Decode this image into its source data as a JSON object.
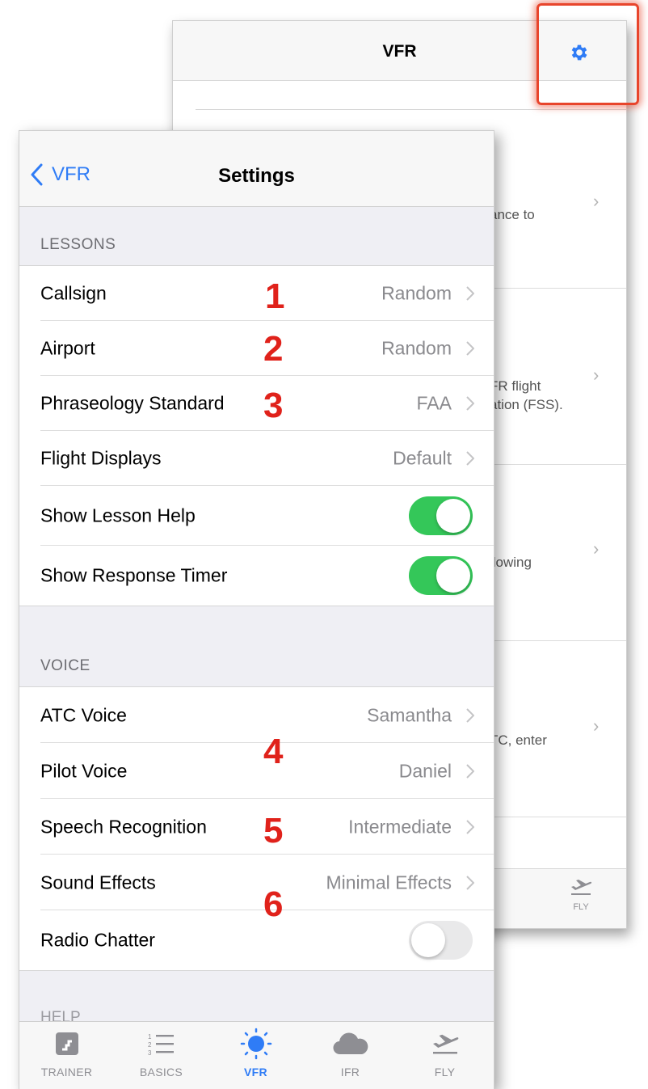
{
  "background_screen": {
    "title": "VFR",
    "row_snippets": [
      "ance to",
      "FR flight\nation (FSS).",
      "llowing",
      "TC, enter"
    ],
    "tab_fly_label": "FLY"
  },
  "settings": {
    "back_label": "VFR",
    "title": "Settings",
    "sections": {
      "lessons_header": "LESSONS",
      "voice_header": "VOICE",
      "help_header_peek": "HELP"
    },
    "lessons": [
      {
        "label": "Callsign",
        "value": "Random"
      },
      {
        "label": "Airport",
        "value": "Random"
      },
      {
        "label": "Phraseology Standard",
        "value": "FAA"
      },
      {
        "label": "Flight Displays",
        "value": "Default"
      },
      {
        "label": "Show Lesson Help",
        "toggle": true
      },
      {
        "label": "Show Response Timer",
        "toggle": true
      }
    ],
    "voice": [
      {
        "label": "ATC Voice",
        "value": "Samantha"
      },
      {
        "label": "Pilot Voice",
        "value": "Daniel"
      },
      {
        "label": "Speech Recognition",
        "value": "Intermediate"
      },
      {
        "label": "Sound Effects",
        "value": "Minimal Effects"
      },
      {
        "label": "Radio Chatter",
        "toggle": false
      }
    ]
  },
  "annotations": [
    "1",
    "2",
    "3",
    "4",
    "5",
    "6"
  ],
  "tabbar": {
    "tabs": [
      {
        "label": "TRAINER",
        "icon": "trainer-icon"
      },
      {
        "label": "BASICS",
        "icon": "list-icon"
      },
      {
        "label": "VFR",
        "icon": "sun-icon",
        "active": true
      },
      {
        "label": "IFR",
        "icon": "cloud-icon"
      },
      {
        "label": "FLY",
        "icon": "airplane-takeoff-icon"
      }
    ]
  },
  "colors": {
    "accent": "#2f7cf6",
    "toggle_on": "#34c759",
    "annotation_red": "#e0221b",
    "highlight": "#e8452c"
  }
}
